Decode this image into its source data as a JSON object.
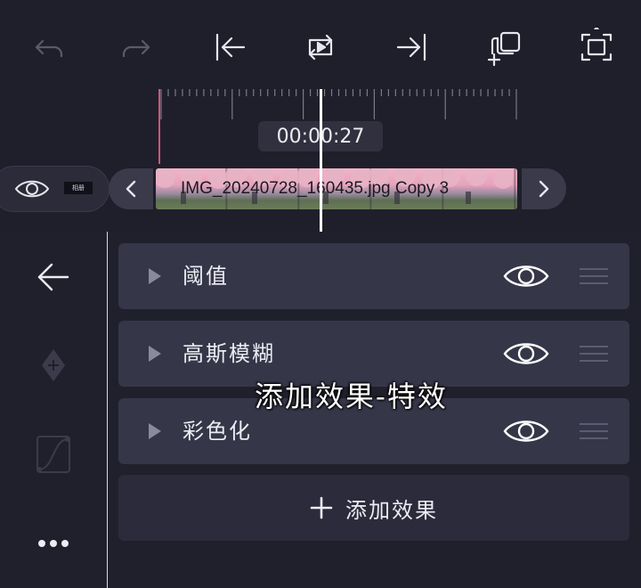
{
  "toolbar": {
    "undo": "undo-icon",
    "redo": "redo-icon",
    "jump_start": "jump-to-start-icon",
    "loop": "loop-play-icon",
    "jump_end": "jump-to-end-icon",
    "add_layer": "add-layer-icon",
    "fullscreen": "fullscreen-icon"
  },
  "timeline": {
    "timecode": "00:00:27",
    "clip_name": "IMG_20240728_160435.jpg Copy 3",
    "track_thumb_text": "相册"
  },
  "effects": [
    {
      "name": "阈值"
    },
    {
      "name": "高斯模糊"
    },
    {
      "name": "彩色化"
    }
  ],
  "add_effect_label": "添加效果",
  "overlay_caption": "添加效果-特效",
  "colors": {
    "background": "#1f1f2b",
    "row": "#363649",
    "accent_marker": "#c85a75",
    "playhead": "#ffffff"
  }
}
